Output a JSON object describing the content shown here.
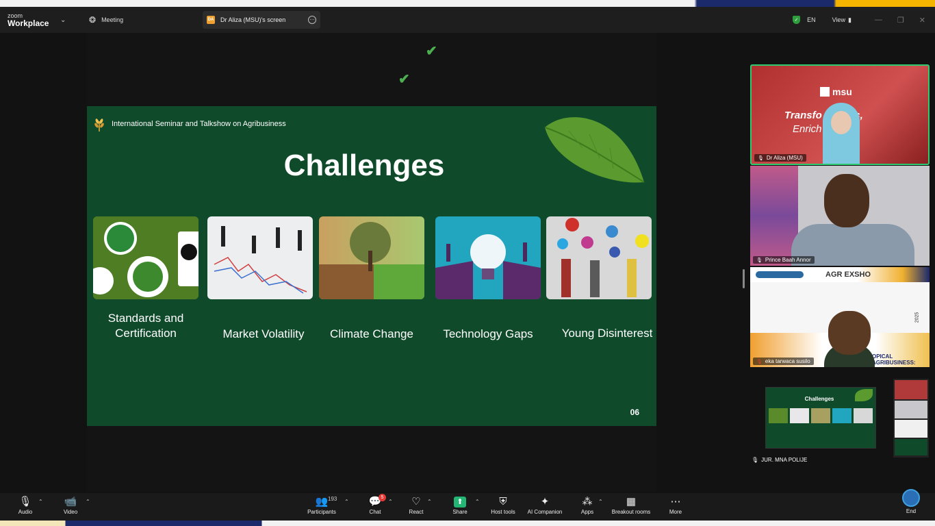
{
  "titlebar": {
    "logo_top": "zoom",
    "logo_bottom": "Workplace",
    "meeting_tab": "Meeting",
    "screen_tab_badge": "DA",
    "screen_tab": "Dr Aliza (MSU)'s screen",
    "language": "EN",
    "view": "View"
  },
  "slide": {
    "header": "International Seminar and Talkshow on Agribusiness",
    "title": "Challenges",
    "page": "06",
    "cards": [
      {
        "label": "Standards and Certification"
      },
      {
        "label": "Market Volatility"
      },
      {
        "label": "Climate Change"
      },
      {
        "label": "Technology Gaps"
      },
      {
        "label": "Young Disinterest"
      }
    ]
  },
  "participants_video": [
    {
      "name": "Dr Aliza (MSU)",
      "banner_brand": "msu",
      "banner_line1": "Transfo   g Lives,",
      "banner_line2": "Enrich    uture"
    },
    {
      "name": "Prince Baah Annor"
    },
    {
      "name": "eka tarwaca susilo",
      "banner_brand": "AGR EXSHO",
      "banner_sub": "OPICAL AGRIBUSINESS:",
      "year": "2025"
    }
  ],
  "mini_share": {
    "title": "Challenges",
    "name": "JUR. MNA POLIJE"
  },
  "toolbar": {
    "audio": "Audio",
    "video": "Video",
    "participants": "Participants",
    "participants_count": "193",
    "chat": "Chat",
    "chat_badge": "5",
    "react": "React",
    "share": "Share",
    "host_tools": "Host tools",
    "ai_companion": "AI Companion",
    "apps": "Apps",
    "breakout": "Breakout rooms",
    "more": "More",
    "end": "End"
  },
  "colors": {
    "slide_green": "#0f4a2a",
    "active_speaker": "#2ecc71",
    "share_green": "#22b573",
    "chat_badge": "#e53935"
  }
}
